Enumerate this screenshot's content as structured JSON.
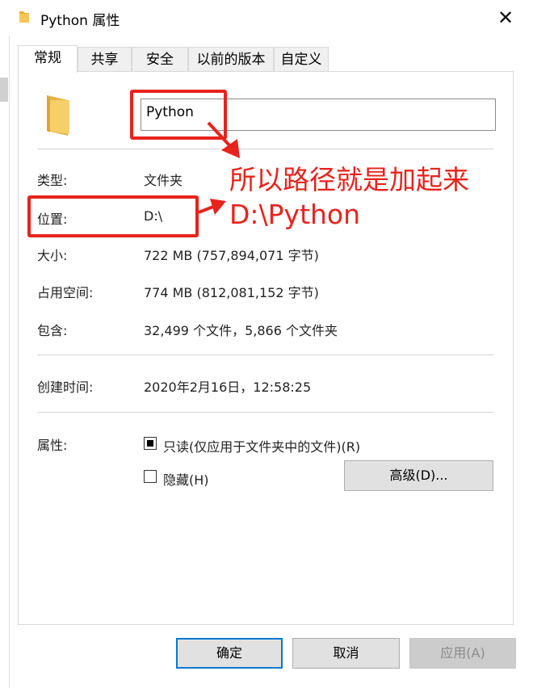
{
  "window": {
    "title": "Python 属性",
    "close_label": "✕"
  },
  "tabs": [
    {
      "label": "常规",
      "active": true
    },
    {
      "label": "共享",
      "active": false
    },
    {
      "label": "安全",
      "active": false
    },
    {
      "label": "以前的版本",
      "active": false
    },
    {
      "label": "自定义",
      "active": false
    }
  ],
  "general": {
    "folder_name": "Python",
    "type_label": "类型:",
    "type_value": "文件夹",
    "location_label": "位置:",
    "location_value": "D:\\",
    "size_label": "大小:",
    "size_value": "722 MB (757,894,071 字节)",
    "size_on_disk_label": "占用空间:",
    "size_on_disk_value": "774 MB (812,081,152 字节)",
    "contains_label": "包含:",
    "contains_value": "32,499 个文件，5,866 个文件夹",
    "created_label": "创建时间:",
    "created_value": "2020年2月16日，12:58:25",
    "attributes_label": "属性:",
    "readonly_label": "只读(仅应用于文件夹中的文件)(R)",
    "readonly_checked": "indeterminate",
    "hidden_label": "隐藏(H)",
    "hidden_checked": false,
    "advanced_label": "高级(D)..."
  },
  "buttons": {
    "ok": "确定",
    "cancel": "取消",
    "apply": "应用(A)"
  },
  "annotation": {
    "line1": "所以路径就是加起来",
    "line2": "D:\\Python",
    "color": "#e8231c"
  },
  "colors": {
    "accent": "#0078d7",
    "folder": "#f5c75a"
  }
}
